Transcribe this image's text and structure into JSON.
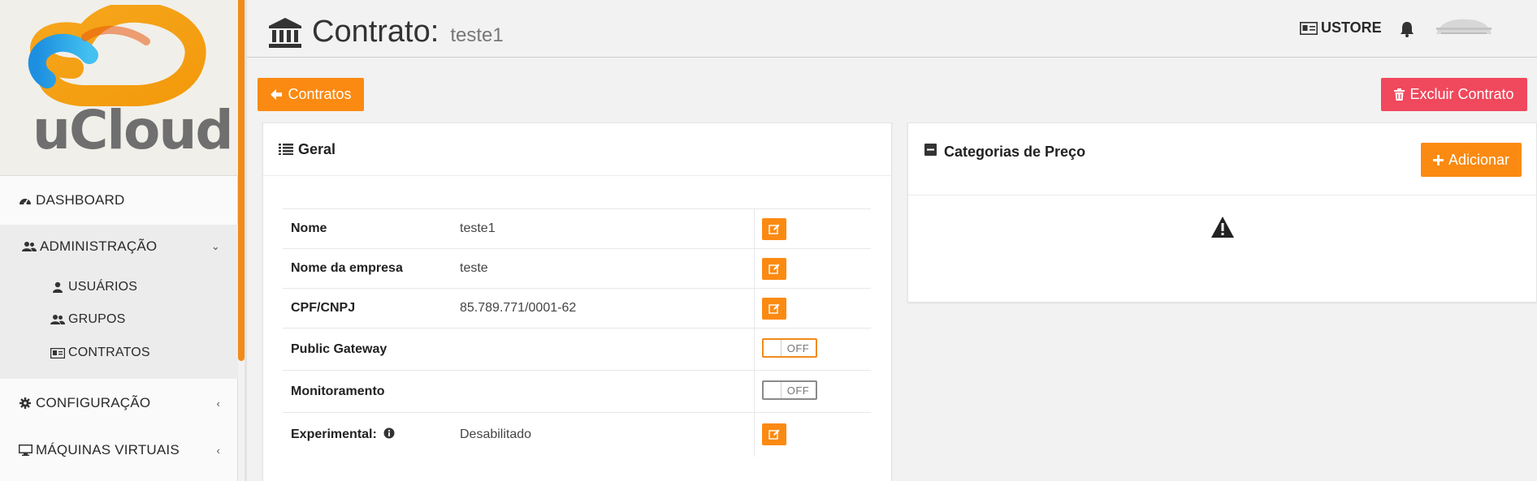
{
  "brand": {
    "name": "uCloud"
  },
  "sidebar": {
    "items": [
      {
        "label": "DASHBOARD",
        "icon": "dashboard-icon"
      },
      {
        "label": "ADMINISTRAÇÃO",
        "icon": "users-icon",
        "expanded": true
      },
      {
        "label": "USUÁRIOS",
        "icon": "user-icon"
      },
      {
        "label": "GRUPOS",
        "icon": "users-icon"
      },
      {
        "label": "CONTRATOS",
        "icon": "id-card-icon"
      },
      {
        "label": "CONFIGURAÇÃO",
        "icon": "gear-icon"
      },
      {
        "label": "MÁQUINAS VIRTUAIS",
        "icon": "desktop-icon"
      }
    ]
  },
  "header": {
    "title": "Contrato:",
    "subtitle": "teste1",
    "title_icon": "bank-icon",
    "account": "USTORE"
  },
  "toolbar": {
    "back_label": "Contratos",
    "delete_label": "Excluir Contrato"
  },
  "general": {
    "title": "Geral",
    "rows": [
      {
        "label": "Nome",
        "value": "teste1"
      },
      {
        "label": "Nome da empresa",
        "value": "teste"
      },
      {
        "label": "CPF/CNPJ",
        "value": "85.789.771/0001-62"
      },
      {
        "label": "Public Gateway",
        "toggle": "OFF"
      },
      {
        "label": "Monitoramento",
        "toggle": "OFF"
      },
      {
        "label": "Experimental:",
        "value": "Desabilitado"
      }
    ]
  },
  "prices": {
    "title": "Categorias de Preço",
    "add_label": "Adicionar"
  },
  "colors": {
    "accent": "#fb8a12",
    "danger": "#f0485c"
  }
}
